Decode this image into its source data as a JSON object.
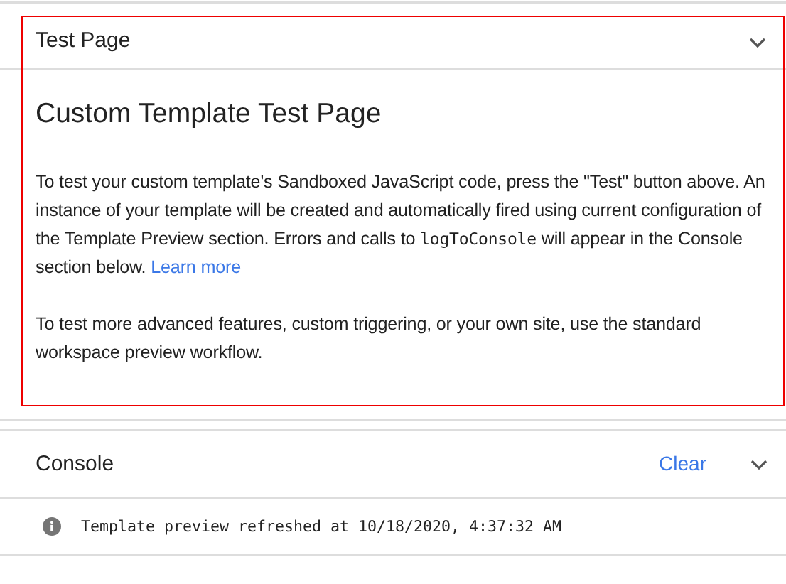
{
  "test_page": {
    "title": "Test Page",
    "expanded": true,
    "highlighted": true,
    "heading": "Custom Template Test Page",
    "paragraphs": [
      {
        "segments": [
          {
            "kind": "text",
            "text": "To test your custom template's Sandboxed JavaScript code, press the \"Test\" button above. An instance of your template will be created and automatically fired using current configuration of the Template Preview section. Errors and calls to "
          },
          {
            "kind": "code",
            "text": "logToConsole"
          },
          {
            "kind": "text",
            "text": " will appear in the Console section below. "
          },
          {
            "kind": "link",
            "text": "Learn more"
          }
        ]
      },
      {
        "segments": [
          {
            "kind": "text",
            "text": "To test more advanced features, custom triggering, or your own site, use the standard workspace preview workflow."
          }
        ]
      }
    ]
  },
  "console": {
    "title": "Console",
    "clear_label": "Clear",
    "expanded": true,
    "messages": [
      {
        "kind": "info",
        "text": "Template preview refreshed at 10/18/2020, 4:37:32 AM"
      }
    ]
  }
}
